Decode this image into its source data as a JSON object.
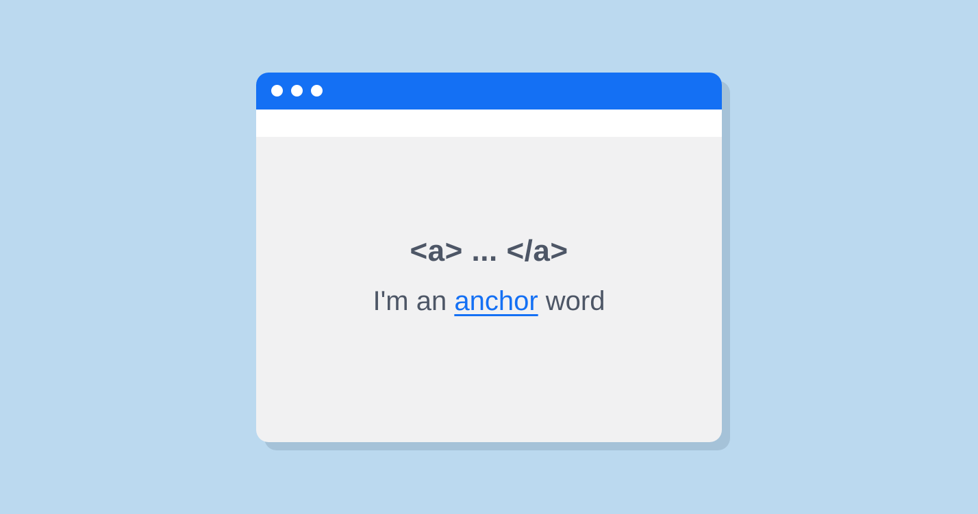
{
  "window": {
    "code_text": "<a> ... </a>",
    "sentence": {
      "before": "I'm an ",
      "link": "anchor",
      "after": " word"
    }
  },
  "colors": {
    "background": "#bbd9ef",
    "title_bar": "#1470f4",
    "content_bg": "#f1f1f2",
    "text": "#4d5666",
    "link": "#1470f4"
  }
}
